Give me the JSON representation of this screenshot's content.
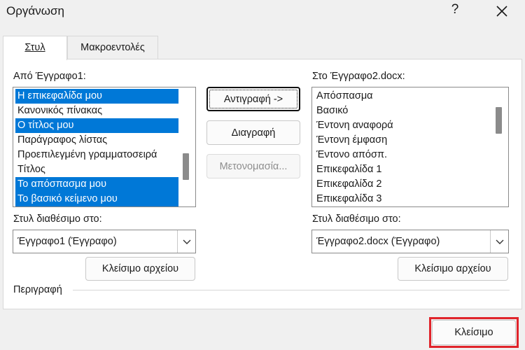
{
  "window": {
    "title": "Οργάνωση",
    "help": "?"
  },
  "tabs": [
    {
      "label": "Στυλ",
      "active": true
    },
    {
      "label": "Μακροεντολές",
      "active": false
    }
  ],
  "left": {
    "label": "Από Έγγραφο1:",
    "items": [
      {
        "text": "Η επικεφαλίδα μου",
        "selected": true
      },
      {
        "text": "Κανονικός πίνακας",
        "selected": false
      },
      {
        "text": "Ο τίτλος μου",
        "selected": true
      },
      {
        "text": "Παράγραφος λίστας",
        "selected": false
      },
      {
        "text": "Προεπιλεγμένη γραμματοσειρά",
        "selected": false
      },
      {
        "text": "Τίτλος",
        "selected": false
      },
      {
        "text": "Το απόσπασμα μου",
        "selected": true
      },
      {
        "text": "Το βασικό κείμενο μου",
        "selected": true
      }
    ],
    "available_label": "Στυλ διαθέσιμο στο:",
    "available_value": "Έγγραφο1 (Έγγραφο)",
    "close_file": "Κλείσιμο αρχείου"
  },
  "right": {
    "label": "Στο Έγγραφο2.docx:",
    "items": [
      {
        "text": "Απόσπασμα"
      },
      {
        "text": "Βασικό"
      },
      {
        "text": "Έντονη αναφορά"
      },
      {
        "text": "Έντονη έμφαση"
      },
      {
        "text": "Έντονο απόσπ."
      },
      {
        "text": "Επικεφαλίδα 1"
      },
      {
        "text": "Επικεφαλίδα 2"
      },
      {
        "text": "Επικεφαλίδα 3"
      }
    ],
    "available_label": "Στυλ διαθέσιμο στο:",
    "available_value": "Έγγραφο2.docx (Έγγραφο)",
    "close_file": "Κλείσιμο αρχείου"
  },
  "actions": {
    "copy": "Αντιγραφή ->",
    "delete": "Διαγραφή",
    "rename": "Μετονομασία..."
  },
  "description_label": "Περιγραφή",
  "close_button": "Κλείσιμο",
  "colors": {
    "selection": "#0078d7",
    "highlight": "#e0242b"
  }
}
